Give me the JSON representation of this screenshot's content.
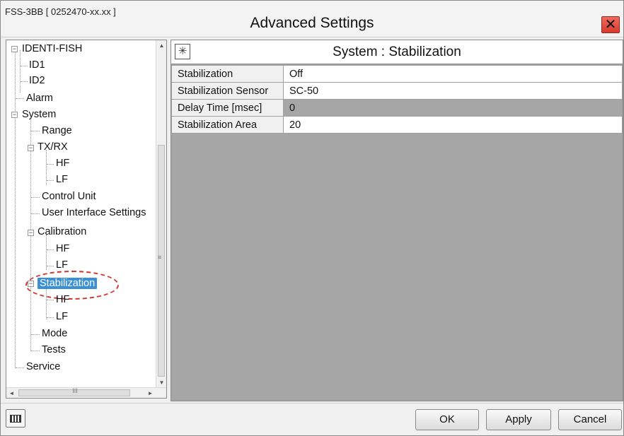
{
  "window": {
    "device_id": "FSS-3BB [ 0252470-xx.xx ]",
    "title": "Advanced Settings",
    "close_glyph": "✕"
  },
  "tree": {
    "nodes": [
      {
        "label": "IDENTI-FISH",
        "expander": "⊟"
      },
      {
        "label": "ID1"
      },
      {
        "label": "ID2"
      },
      {
        "label": "Alarm"
      },
      {
        "label": "System",
        "expander": "⊟"
      },
      {
        "label": "Range"
      },
      {
        "label": "TX/RX",
        "expander": "⊟"
      },
      {
        "label": "HF"
      },
      {
        "label": "LF"
      },
      {
        "label": "Control Unit"
      },
      {
        "label": "User Interface Settings"
      },
      {
        "label": "Calibration",
        "expander": "⊟"
      },
      {
        "label": "HF"
      },
      {
        "label": "LF"
      },
      {
        "label": "Stabilization",
        "selected": true,
        "expander": "⊟"
      },
      {
        "label": "HF"
      },
      {
        "label": "LF"
      },
      {
        "label": "Mode"
      },
      {
        "label": "Tests"
      },
      {
        "label": "Service"
      }
    ],
    "scroll_up": "▲",
    "scroll_down": "▼",
    "scroll_left": "◄",
    "scroll_right": "►",
    "vgrip": "≡",
    "hgrip": "III"
  },
  "content": {
    "icon": "stabilization-icon",
    "title": "System : Stabilization",
    "rows": [
      {
        "label": "Stabilization",
        "value": "Off"
      },
      {
        "label": "Stabilization Sensor",
        "value": "SC-50"
      },
      {
        "label": "Delay Time [msec]",
        "value": "0",
        "disabled": true
      },
      {
        "label": "Stabilization Area",
        "value": "20"
      }
    ]
  },
  "footer": {
    "keyboard_icon": "keyboard-icon",
    "ok_label": "OK",
    "apply_label": "Apply",
    "cancel_label": "Cancel"
  },
  "colors": {
    "selected_bg": "#3a8fd6",
    "highlight_ring": "#d0342c",
    "disabled_cell": "#a6a6a6",
    "close_button": "#e0463a"
  }
}
